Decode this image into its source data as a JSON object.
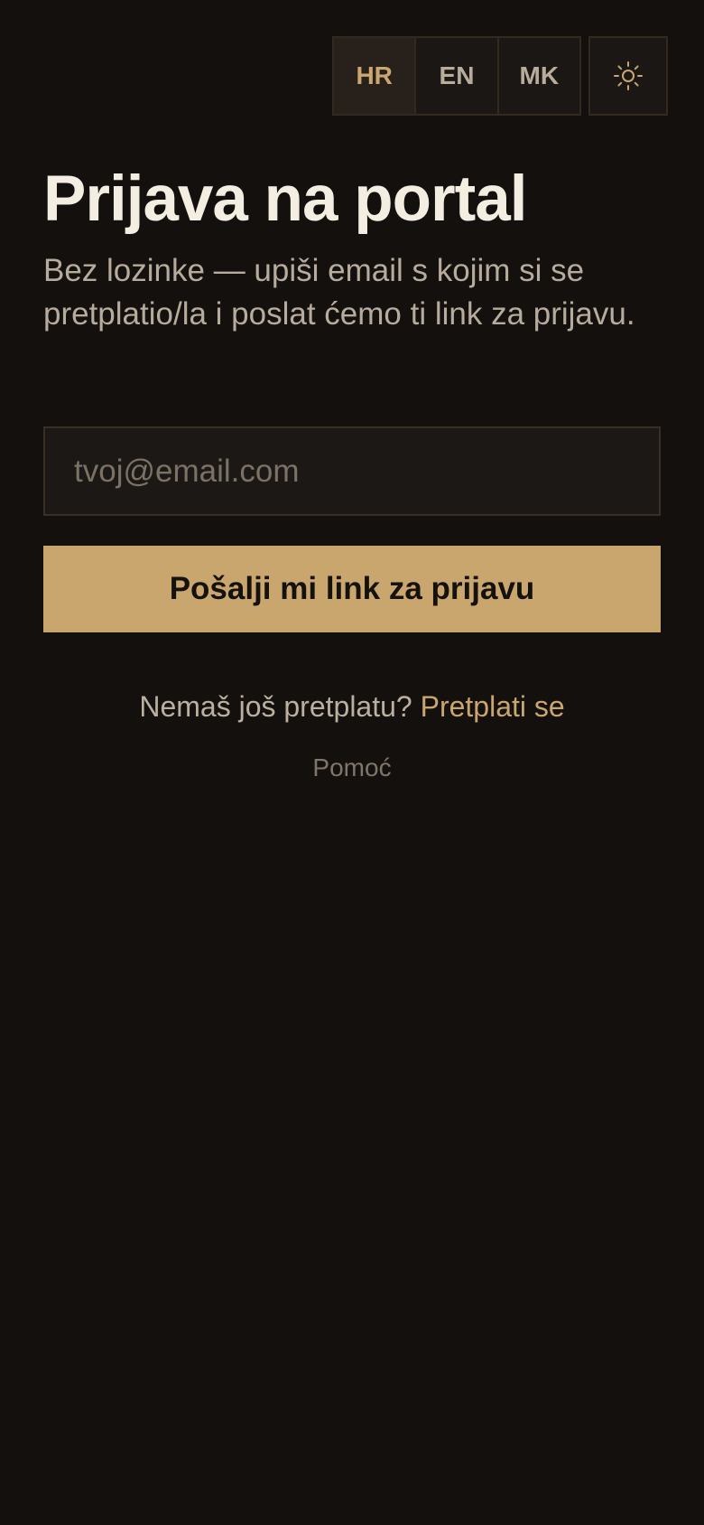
{
  "header": {
    "languages": [
      {
        "code": "HR",
        "active": true
      },
      {
        "code": "EN",
        "active": false
      },
      {
        "code": "MK",
        "active": false
      }
    ],
    "theme_toggle_icon": "sun-icon"
  },
  "login": {
    "title": "Prijava na portal",
    "subtitle": "Bez lozinke — upiši email s kojim si se pretplatio/la i poslat ćemo ti link za prijavu.",
    "email_placeholder": "tvoj@email.com",
    "email_value": "",
    "submit_label": "Pošalji mi link za prijavu",
    "no_subscription_text": "Nemaš još pretplatu?",
    "subscribe_link": "Pretplati se",
    "help_link": "Pomoć"
  },
  "colors": {
    "background": "#13100e",
    "accent": "#caa66f",
    "title_text": "#f3ede2",
    "muted_text": "#b6ab9c"
  }
}
